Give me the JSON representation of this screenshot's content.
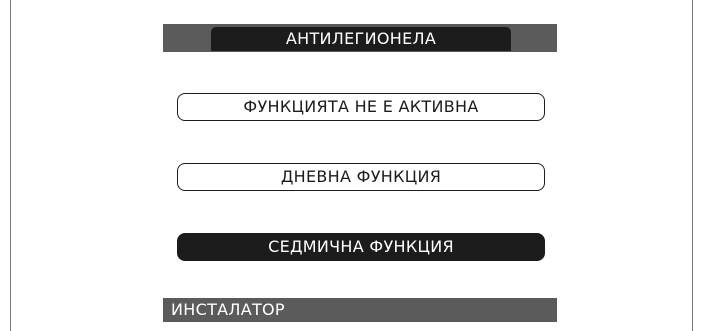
{
  "screen": {
    "title": "АНТИЛЕГИОНЕЛА",
    "options": [
      {
        "label": "ФУНКЦИЯТА НЕ Е АКТИВНА",
        "selected": false
      },
      {
        "label": "ДНЕВНА ФУНКЦИЯ",
        "selected": false
      },
      {
        "label": "СЕДМИЧНА ФУНКЦИЯ",
        "selected": true
      }
    ],
    "footer": "ИНСТАЛАТОР"
  },
  "colors": {
    "dark": "#1c1c1c",
    "bar_gray": "#5b5b5b",
    "background": "#ffffff"
  }
}
